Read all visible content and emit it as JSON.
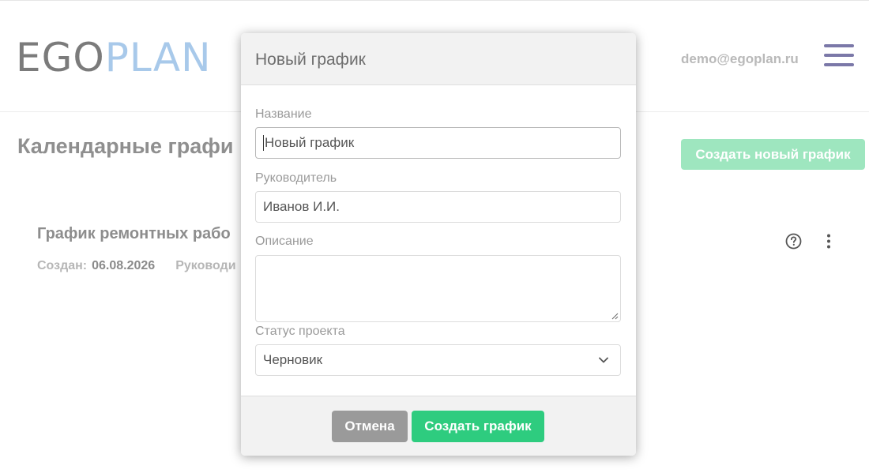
{
  "header": {
    "logo_ego": "EGO",
    "logo_plan": "PLAN",
    "user_email": "demo@egoplan.ru",
    "menu_icon": "hamburger-menu-icon"
  },
  "page": {
    "title": "Календарные графи",
    "create_new_label": "Создать новый график",
    "schedule": {
      "title": "График ремонтных рабо",
      "created_label": "Создан:",
      "created_value": "06.08.2026",
      "leader_label": "Руководи"
    },
    "icons": {
      "help": "help-circle-icon",
      "more": "more-vertical-icon"
    }
  },
  "modal": {
    "title": "Новый график",
    "fields": {
      "name": {
        "label": "Название",
        "value": "Новый график"
      },
      "leader": {
        "label": "Руководитель",
        "value": "Иванов И.И."
      },
      "description": {
        "label": "Описание",
        "value": ""
      },
      "status": {
        "label": "Статус проекта",
        "value": "Черновик"
      }
    },
    "cancel_label": "Отмена",
    "create_label": "Создать график"
  },
  "colors": {
    "logo_ego": "#7b7b7b",
    "logo_plan": "#a8c9ea",
    "menu": "#7b78a8",
    "primary_green": "#2ecc7f",
    "disabled_green": "#9ee6bf",
    "cancel_gray": "#9a9a9a"
  }
}
